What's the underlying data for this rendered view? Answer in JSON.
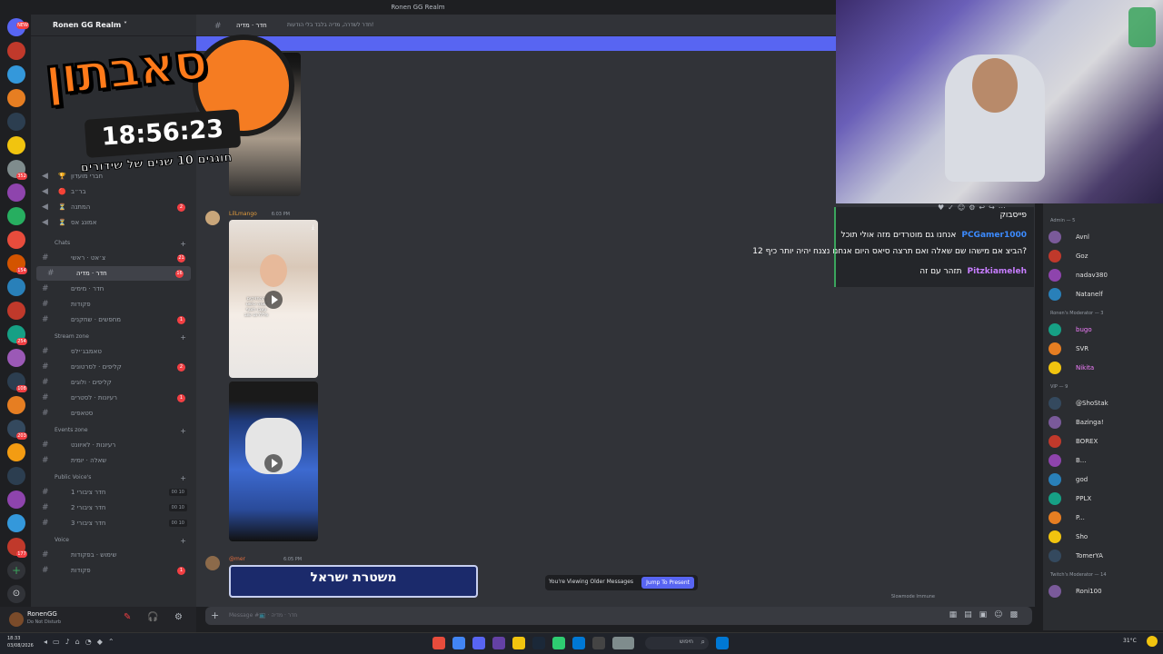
{
  "window": {
    "title": "Ronen GG Realm"
  },
  "server": {
    "name": "Ronen GG Realm ˅"
  },
  "rail_badges": [
    "NEW",
    "352",
    "154",
    "1",
    "6",
    "254",
    "5",
    "108",
    "203",
    "16",
    "6",
    "177"
  ],
  "sidebar": {
    "top_channels": [
      {
        "icon": "🏆",
        "label": "חברי מועדון"
      },
      {
        "icon": "🔴",
        "label": "בר״ב"
      },
      {
        "icon": "⏳",
        "label": "המתנה",
        "badge": "2"
      },
      {
        "icon": "⏳",
        "label": "אמונג אס"
      }
    ],
    "categories": [
      {
        "label": "Chats",
        "channels": [
          {
            "label": "צ׳אט · ראשי",
            "badge": "21"
          },
          {
            "label": "חדר · מדיה",
            "badge": "16",
            "selected": true
          },
          {
            "label": "חדר · מימים"
          },
          {
            "label": "פקודות"
          },
          {
            "label": "מחפשים · שחקנים",
            "badge": "1"
          }
        ]
      },
      {
        "label": "Stream zone",
        "channels": [
          {
            "label": "טאמבג׳ילס"
          },
          {
            "label": "קליפים · לסרטונים",
            "badge": "2"
          },
          {
            "label": "קליפים · ולוגים"
          },
          {
            "label": "רעיונות · לסטרים",
            "badge": "1"
          },
          {
            "label": "סטאפים"
          }
        ]
      },
      {
        "label": "Events zone",
        "channels": [
          {
            "label": "רעיונות · לאיוונט"
          },
          {
            "label": "שאלה · יומית"
          }
        ]
      },
      {
        "label": "Public Voice's",
        "channels": [
          {
            "label": "חדר ציבורי 1",
            "count": "00 10"
          },
          {
            "label": "חדר ציבורי 2",
            "count": "00 10"
          },
          {
            "label": "חדר ציבורי 3",
            "count": "00 10"
          }
        ]
      },
      {
        "label": "Voice",
        "channels": [
          {
            "label": "שימוש · בפקודות"
          },
          {
            "label": "פקודות",
            "badge": "1"
          }
        ]
      }
    ],
    "user": {
      "name": "RonenGG",
      "status": "Do Not Disturb"
    }
  },
  "chat": {
    "header": "חדר · מדיה",
    "header_topic": "חדר לשדרה, מדיה בלבד בלי הודעות!",
    "messages": [
      {
        "author": "LilLmango",
        "time": "6:03 PM",
        "color": "#e09b3d"
      },
      {
        "author": "@mer",
        "time": "6:05 PM",
        "color": "#e06c3d"
      }
    ],
    "video_caption_1": "ההחזיקים שמה כושט עצבו תצוף פללרנט שוב",
    "police_text": "משטרת ישראל",
    "older_label": "You're Viewing Older Messages",
    "jump_label": "Jump To Present",
    "input_placeholder": "Message #📺 · חדר · מדיה",
    "slowmode": "Slowmode Immune"
  },
  "stream": {
    "marathon_title": "סאבתון",
    "timer": "18:56:23",
    "subtitle": "חוגגים 10 שנים של שידורים",
    "twitch_chat": [
      {
        "user": "",
        "text": "פייסבוק",
        "color": "#ffffff"
      },
      {
        "user": "PCGamer1000",
        "text": "אנחנו גם מוטרדים מזה אולי תוכל",
        "color": "#3c8bff"
      },
      {
        "user": "",
        "text": "12 הביצ אם מישהו שם שאלה ואם תרצה סיאס היום אנחנו נצנח יהיה יותר כיף?",
        "color": "#ffffff"
      },
      {
        "user": "Pitzkiameleh",
        "text": "תזהר עם זה",
        "color": "#c77dff"
      }
    ]
  },
  "members": {
    "groups": [
      {
        "label": "Admin — 5",
        "members": [
          {
            "name": "Avnl",
            "color": "#e0e0e0"
          },
          {
            "name": "Goz",
            "color": "#e0e0e0"
          },
          {
            "name": "nadav380",
            "color": "#e0e0e0"
          },
          {
            "name": "Natanelf",
            "color": "#e0e0e0"
          }
        ]
      },
      {
        "label": "Ronen's Moderator — 3",
        "members": [
          {
            "name": "bugo",
            "color": "#f47fff"
          },
          {
            "name": "SVR",
            "color": "#e0e0e0"
          },
          {
            "name": "Nikita",
            "color": "#f47fff"
          }
        ]
      },
      {
        "label": "VIP — 9",
        "members": [
          {
            "name": "@ShoStak",
            "color": "#e0e0e0"
          },
          {
            "name": "Bazinga!",
            "color": "#e0e0e0"
          },
          {
            "name": "BOREX",
            "color": "#e0e0e0"
          },
          {
            "name": "B...",
            "color": "#e0e0e0"
          },
          {
            "name": "god",
            "color": "#e0e0e0"
          },
          {
            "name": "PPLX",
            "color": "#e0e0e0"
          },
          {
            "name": "P...",
            "color": "#e0e0e0"
          },
          {
            "name": "Sho",
            "color": "#e0e0e0"
          },
          {
            "name": "TomerYA",
            "color": "#e0e0e0"
          }
        ]
      },
      {
        "label": "Twitch's Moderator — 14",
        "members": [
          {
            "name": "Roni100",
            "color": "#e0e0e0"
          }
        ]
      }
    ]
  },
  "taskbar": {
    "time": "18:33",
    "date": "03/08/2026",
    "search_placeholder": "חיפוש",
    "weather": "31°C"
  }
}
